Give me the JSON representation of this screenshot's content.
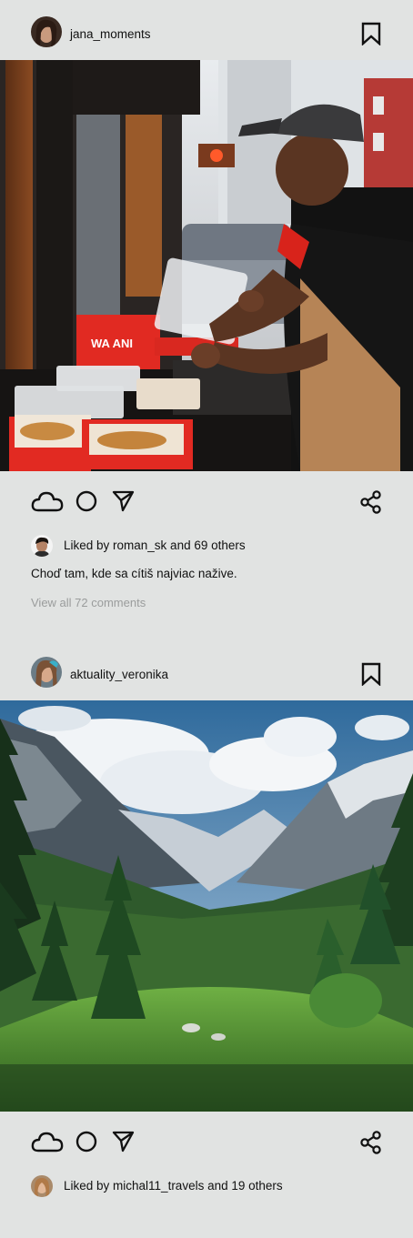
{
  "posts": [
    {
      "username": "jana_moments",
      "photo_icon": "food-vendor-photo",
      "liked_by_user": "roman_sk",
      "liked_text": "Liked by roman_sk and 69 others",
      "caption": "Choď tam, kde sa cítiš najviac nažive.",
      "comments_link": "View all 72 comments",
      "sign_text": "WA ANI"
    },
    {
      "username": "aktuality_veronika",
      "photo_icon": "mountain-valley-photo",
      "liked_by_user": "michal11_travels",
      "liked_text": "Liked by michal11_travels and 19 others"
    }
  ],
  "icons": {
    "like": "cloud-icon",
    "comment": "circle-icon",
    "send": "paper-plane-icon",
    "share": "share-icon",
    "save": "bookmark-icon"
  },
  "colors": {
    "background": "#e1e3e2",
    "text": "#111111",
    "muted": "#9a9c9c"
  }
}
